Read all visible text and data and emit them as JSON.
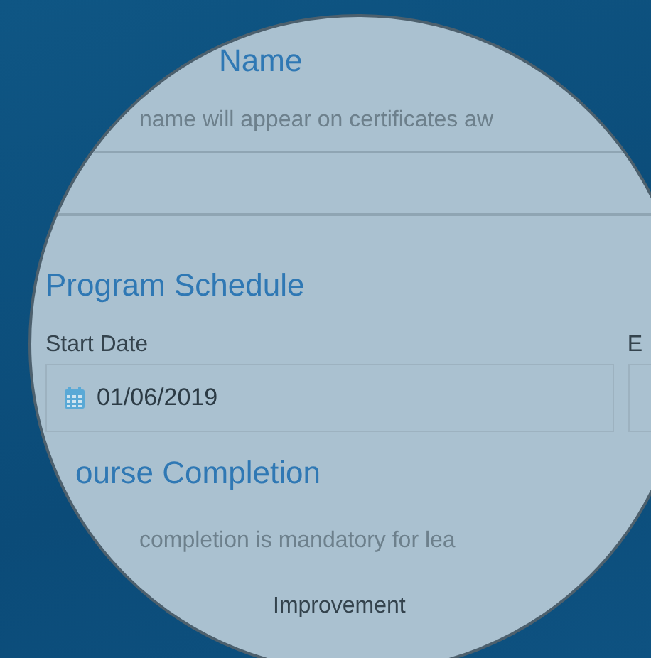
{
  "name_section": {
    "heading": "Name",
    "hint": "name will appear on certificates aw"
  },
  "schedule_section": {
    "heading": "Program Schedule",
    "start_date": {
      "label": "Start Date",
      "value": "01/06/2019"
    },
    "end_date": {
      "label": "E"
    }
  },
  "completion_section": {
    "heading": "ourse Completion",
    "hint": "completion is mandatory for lea",
    "option": "Improvement"
  }
}
